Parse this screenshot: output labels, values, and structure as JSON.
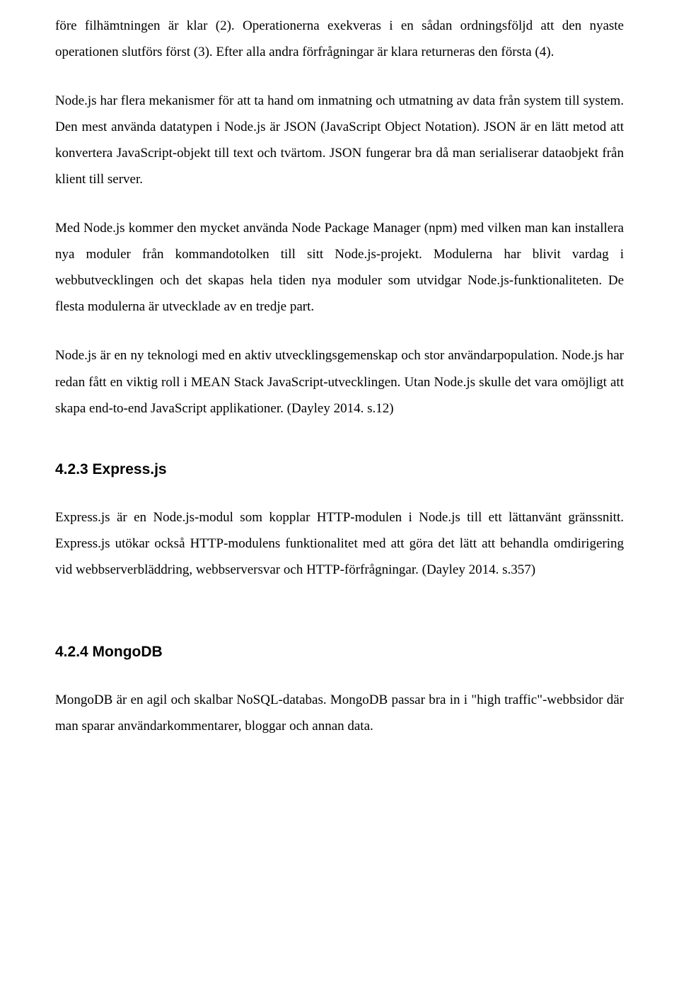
{
  "paragraphs": {
    "p1": "före filhämtningen är klar (2). Operationerna exekveras i en sådan ordningsföljd att den nyaste operationen slutförs först (3). Efter alla andra förfrågningar är klara returneras den första (4).",
    "p2": "Node.js har flera mekanismer för att ta hand om inmatning och utmatning av data från system till system. Den mest använda datatypen i Node.js är JSON (JavaScript Object Notation). JSON är en lätt metod att konvertera JavaScript-objekt till text och tvärtom. JSON fungerar bra då man serialiserar dataobjekt från klient till server.",
    "p3": "Med Node.js kommer den mycket använda Node Package Manager (npm) med vilken man kan installera nya moduler från kommandotolken till sitt Node.js-projekt. Modulerna har blivit vardag i webbutvecklingen och det skapas hela tiden nya moduler som utvidgar Node.js-funktionaliteten. De flesta modulerna är utvecklade av en tredje part.",
    "p4": "Node.js är en ny teknologi med en aktiv utvecklingsgemenskap och stor användarpopulation. Node.js har redan fått en viktig roll i MEAN Stack JavaScript-utvecklingen. Utan Node.js skulle det vara omöjligt att skapa end-to-end JavaScript applikationer. (Dayley 2014. s.12)",
    "p5": "Express.js är en Node.js-modul som kopplar HTTP-modulen i Node.js till ett lättanvänt gränssnitt. Express.js utökar också HTTP-modulens funktionalitet med att göra det lätt att behandla omdirigering vid webbserverbläddring, webbserversvar och HTTP-förfrågningar. (Dayley 2014. s.357)",
    "p6": "MongoDB är en agil och skalbar NoSQL-databas. MongoDB passar bra in i \"high traffic\"-webbsidor där man sparar användarkommentarer, bloggar och annan data."
  },
  "headings": {
    "h1": "4.2.3  Express.js",
    "h2": "4.2.4  MongoDB"
  }
}
